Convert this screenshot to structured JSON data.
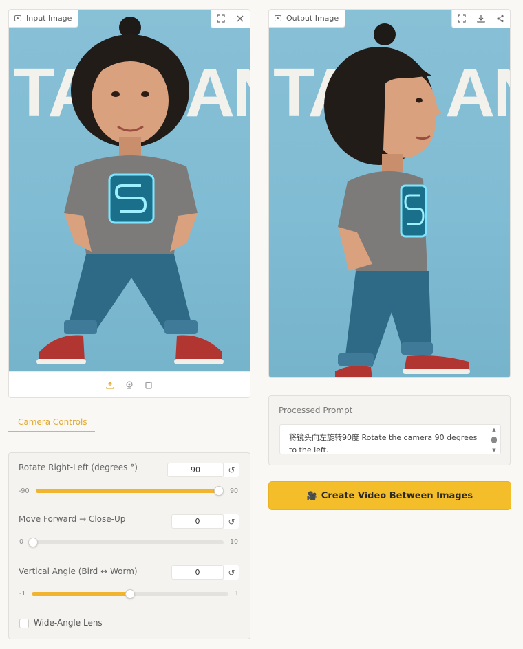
{
  "input_panel": {
    "label": "Input Image",
    "poster_text": "TA AN",
    "toolbar_icons": [
      "fullscreen-icon",
      "close-icon"
    ],
    "bottom_icons": [
      "upload-icon",
      "webcam-icon",
      "clipboard-icon"
    ]
  },
  "output_panel": {
    "label": "Output Image",
    "poster_text": "TA AN",
    "toolbar_icons": [
      "fullscreen-icon",
      "download-icon",
      "share-icon"
    ]
  },
  "tabs": {
    "active": "Camera Controls"
  },
  "controls": {
    "rotate": {
      "label": "Rotate Right-Left (degrees °)",
      "value": "90",
      "min": "-90",
      "max": "90",
      "fraction": 1.0
    },
    "forward": {
      "label": "Move Forward → Close-Up",
      "value": "0",
      "min": "0",
      "max": "10",
      "fraction": 0.0
    },
    "vertical": {
      "label": "Vertical Angle (Bird ↔ Worm)",
      "value": "0",
      "min": "-1",
      "max": "1",
      "fraction": 0.5
    },
    "wide_angle": {
      "label": "Wide-Angle Lens",
      "checked": false
    },
    "reset_glyph": "↺"
  },
  "prompt": {
    "title": "Processed Prompt",
    "text": "将镜头向左旋转90度 Rotate the camera 90 degrees to the left."
  },
  "create_button": {
    "icon": "🎥",
    "label": "Create Video Between Images"
  },
  "colors": {
    "accent": "#f1b42f",
    "background": "#f9f8f5",
    "photo_backdrop": "#82bdd4"
  }
}
